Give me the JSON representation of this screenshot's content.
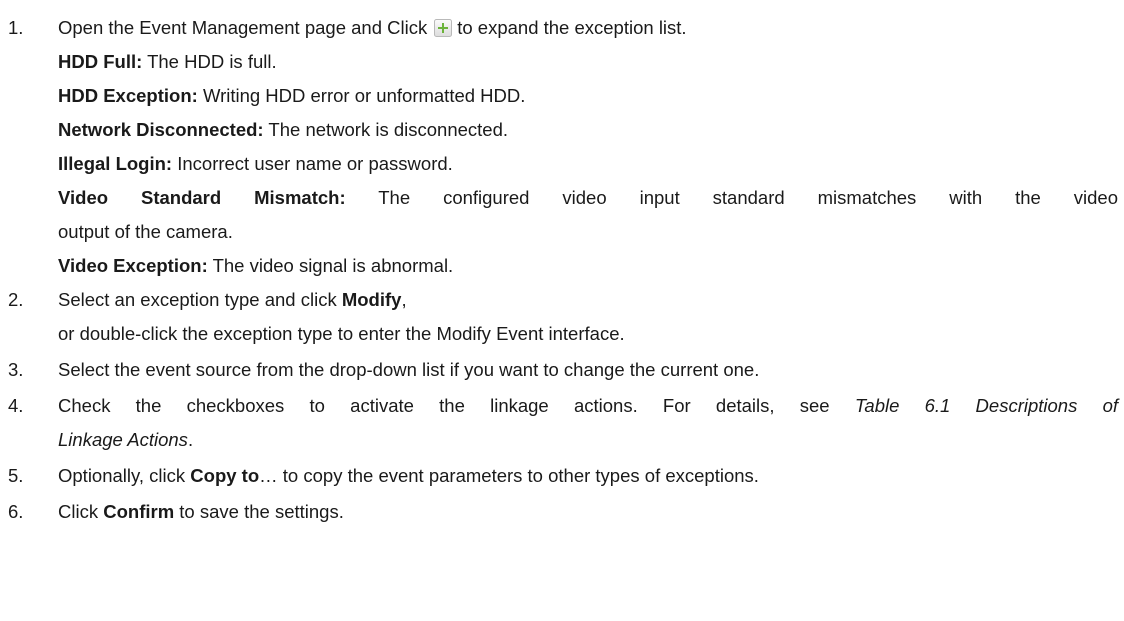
{
  "steps": [
    {
      "num": "1.",
      "text_before_icon": "Open the Event Management page and Click",
      "icon": "expand-plus-icon",
      "text_after_icon": "to expand the exception list.",
      "definitions": [
        {
          "term": "HDD Full:",
          "desc": "The HDD is full."
        },
        {
          "term": "HDD Exception:",
          "desc": "Writing HDD error or unformatted HDD."
        },
        {
          "term": "Network Disconnected:",
          "desc": "The network is disconnected."
        },
        {
          "term": "Illegal Login:",
          "desc": "Incorrect user name or password."
        },
        {
          "term": "Video Standard Mismatch:",
          "desc": "The configured video input standard mismatches with the video",
          "desc_cont": "output of the camera."
        },
        {
          "term": "Video Exception:",
          "desc": "The video signal is abnormal."
        }
      ]
    },
    {
      "num": "2.",
      "line1_pre": "Select an exception type and click",
      "line1_bold": "Modify",
      "line1_post": ",",
      "line2": "or double-click the exception type to enter the Modify Event interface."
    },
    {
      "num": "3.",
      "text": "Select the event source from the drop-down list if you want to change the current one."
    },
    {
      "num": "4.",
      "line1_pre": "Check the checkboxes to activate the linkage actions. For details, see",
      "line1_italic": "Table 6.1 Descriptions of",
      "line2_italic": "Linkage Actions",
      "line2_post": "."
    },
    {
      "num": "5.",
      "pre": "Optionally, click",
      "bold": "Copy to",
      "post": "… to copy the event parameters to other types of exceptions."
    },
    {
      "num": "6.",
      "pre": "Click",
      "bold": "Confirm",
      "post": "to save the settings."
    }
  ]
}
